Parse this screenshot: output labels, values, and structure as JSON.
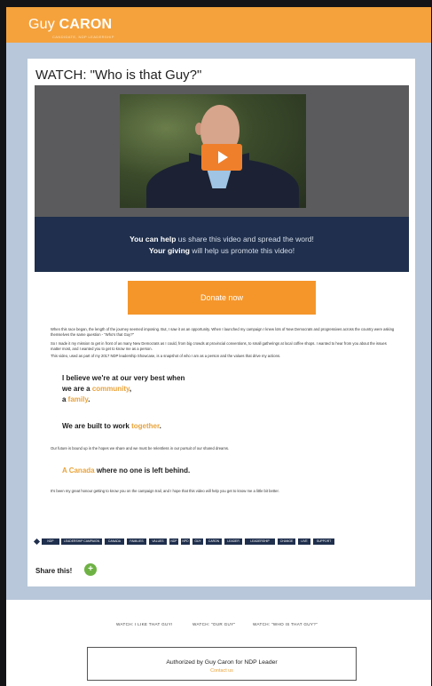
{
  "header": {
    "brand_first": "Guy ",
    "brand_last": "CARON",
    "tagline": "CANDIDATE, NDP LEADERSHIP"
  },
  "page": {
    "title": "WATCH: \"Who is that Guy?\""
  },
  "video": {
    "share_line1_bold": "You can help",
    "share_line1_rest": " us share this video and spread the word!",
    "share_line2_bold": "Your giving",
    "share_line2_rest": " will help us promote this video!"
  },
  "donate_label": "Donate now",
  "paragraphs": [
    "When this race began, the length of the journey seemed imposing. But, I saw it as an opportunity. When I launched my campaign I knew lots of New Democrats and progressives across the country were asking themselves the same question - \"Who's that Guy?\"",
    "So I made it my mission to get in front of as many New Democrats as I could, from big crowds at provincial conventions, to small gatherings at local coffee shops. I wanted to hear from you about the issues matter most, and I wanted you to get to know me as a person.",
    "This video, used as part of my 2017 NDP leadership Showcase, is a snapshot of who I am as a person and the values that drive my actions."
  ],
  "quote1": {
    "line1": "I believe we're at our very best when",
    "line2_pre": "we are a ",
    "line2_hl": "community",
    "line2_post": ",",
    "line3_pre": "a ",
    "line3_hl": "family",
    "line3_post": "."
  },
  "quote2": {
    "pre": "We are built to work ",
    "hl": "together",
    "post": "."
  },
  "paragraph4": "Our future is bound up in the hopes we share and we must be relentless in our pursuit of our shared dreams.",
  "quote3": {
    "hl": "A Canada",
    "rest": " where no one is left behind."
  },
  "paragraph5": "It's been my great honour getting to know you on the campaign trail, and I hope that this video will help you get to know me a little bit better.",
  "tags": [
    "NDP",
    "LEADERSHIP CAMPAIGN",
    "CANADA",
    "FAMILIES",
    "VALUES",
    "NDP",
    "NPD",
    "GUY",
    "CARON",
    "LEADER",
    "LEADERSHIP",
    "CHANGE",
    "LIVE",
    "SUPPORT"
  ],
  "share": {
    "label": "Share this!",
    "button_icon": "share-plus-icon"
  },
  "footer": {
    "nav": [
      "WATCH: I LIKE THAT GUY!",
      "WATCH: \"OUR GUY\"",
      "WATCH: \"WHO IS THAT GUY?\""
    ],
    "auth_line1": "Authorized by Guy Caron for NDP Leader",
    "auth_line2": "Contact us"
  },
  "colors": {
    "brand_orange": "#f5a23c",
    "navy": "#1f2f4d",
    "accent_gold": "#e9a33a",
    "share_green": "#6eb244",
    "page_bg": "#b8c7d9"
  }
}
